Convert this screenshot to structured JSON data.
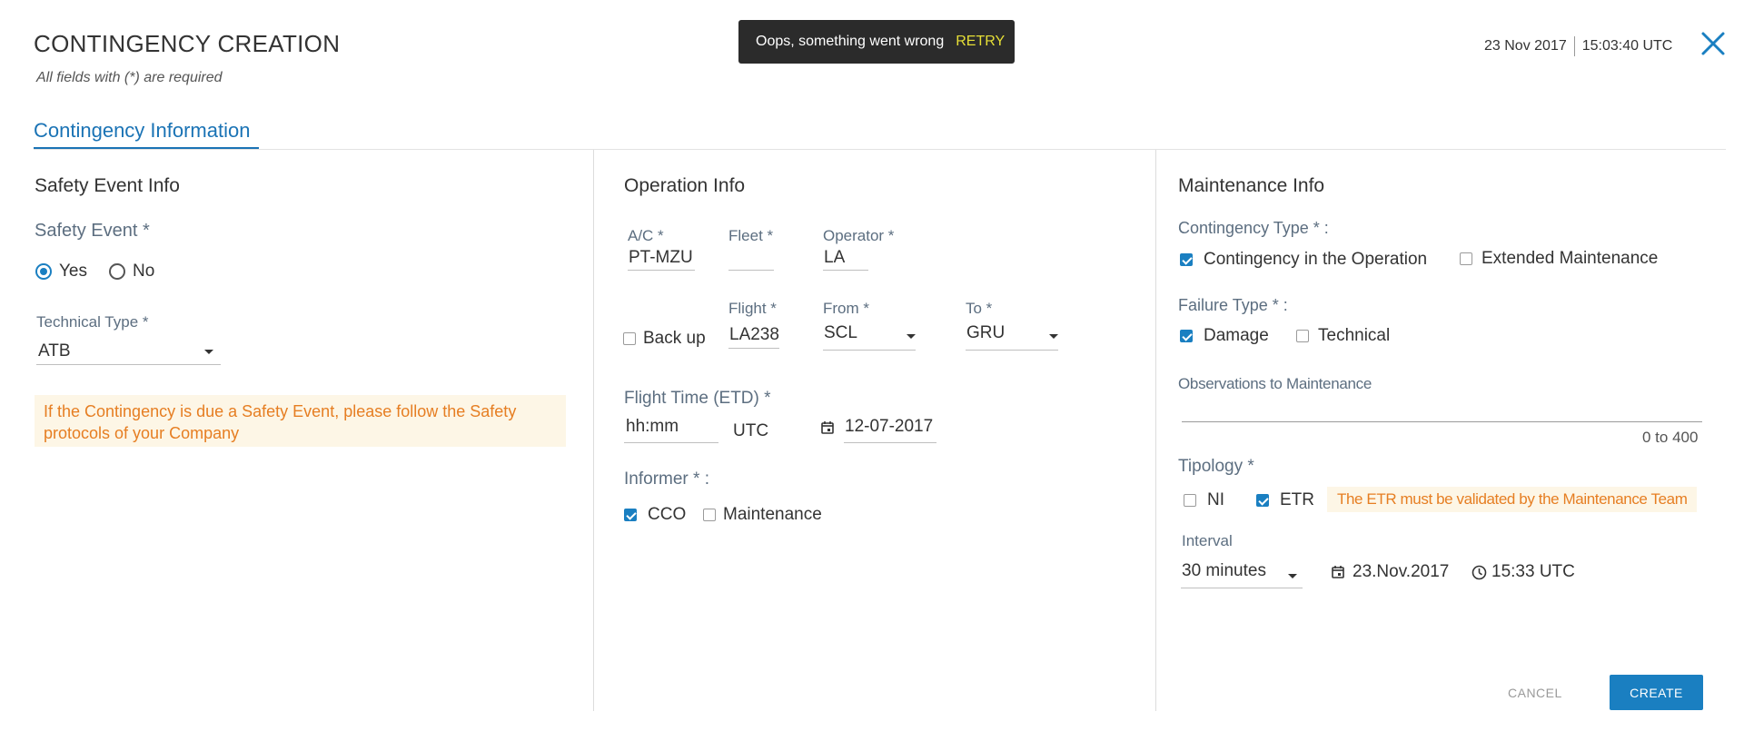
{
  "header": {
    "title": "CONTINGENCY CREATION",
    "subtitle": "All fields with (*) are required",
    "date": "23 Nov 2017",
    "time": "15:03:40 UTC"
  },
  "toast": {
    "message": "Oops, something went wrong",
    "action": "RETRY"
  },
  "tabs": [
    {
      "label": "Contingency Information",
      "active": true
    }
  ],
  "safety": {
    "heading": "Safety Event Info",
    "event_label": "Safety Event *",
    "yes": "Yes",
    "no": "No",
    "selected": "Yes",
    "technical_type_label": "Technical Type *",
    "technical_type_value": "ATB",
    "warning": "If the Contingency is due a Safety Event, please follow the Safety protocols of your Company"
  },
  "operation": {
    "heading": "Operation Info",
    "ac_label": "A/C *",
    "ac_value": "PT-MZU",
    "fleet_label": "Fleet *",
    "fleet_value": "",
    "operator_label": "Operator *",
    "operator_value": "LA",
    "backup_label": "Back up",
    "flight_label": "Flight *",
    "flight_value": "LA238",
    "from_label": "From *",
    "from_value": "SCL",
    "to_label": "To *",
    "to_value": "GRU",
    "flight_time_label": "Flight Time (ETD) *",
    "flight_time_placeholder": "hh:mm",
    "utc": "UTC",
    "date_value": "12-07-2017",
    "informer_label": "Informer * :",
    "informer_cco": "CCO",
    "informer_maintenance": "Maintenance"
  },
  "maintenance": {
    "heading": "Maintenance Info",
    "contingency_type_label": "Contingency Type * :",
    "contingency_in_operation": "Contingency in the Operation",
    "extended_maintenance": "Extended Maintenance",
    "failure_type_label": "Failure Type * :",
    "damage": "Damage",
    "technical": "Technical",
    "observations_label": "Observations to Maintenance",
    "observations_counter": "0 to 400",
    "tipology_label": "Tipology *",
    "ni": "NI",
    "etr": "ETR",
    "etr_warning": "The ETR must be validated by the Maintenance Team",
    "interval_label": "Interval",
    "interval_value": "30 minutes",
    "interval_date": "23.Nov.2017",
    "interval_time": "15:33 UTC"
  },
  "actions": {
    "cancel": "CANCEL",
    "create": "CREATE"
  },
  "colors": {
    "accent": "#1a7fc1",
    "warning_text": "#e67e22",
    "warning_bg": "#fdf6e6",
    "toast_bg": "#2b2b2b",
    "toast_action": "#e6df36"
  }
}
